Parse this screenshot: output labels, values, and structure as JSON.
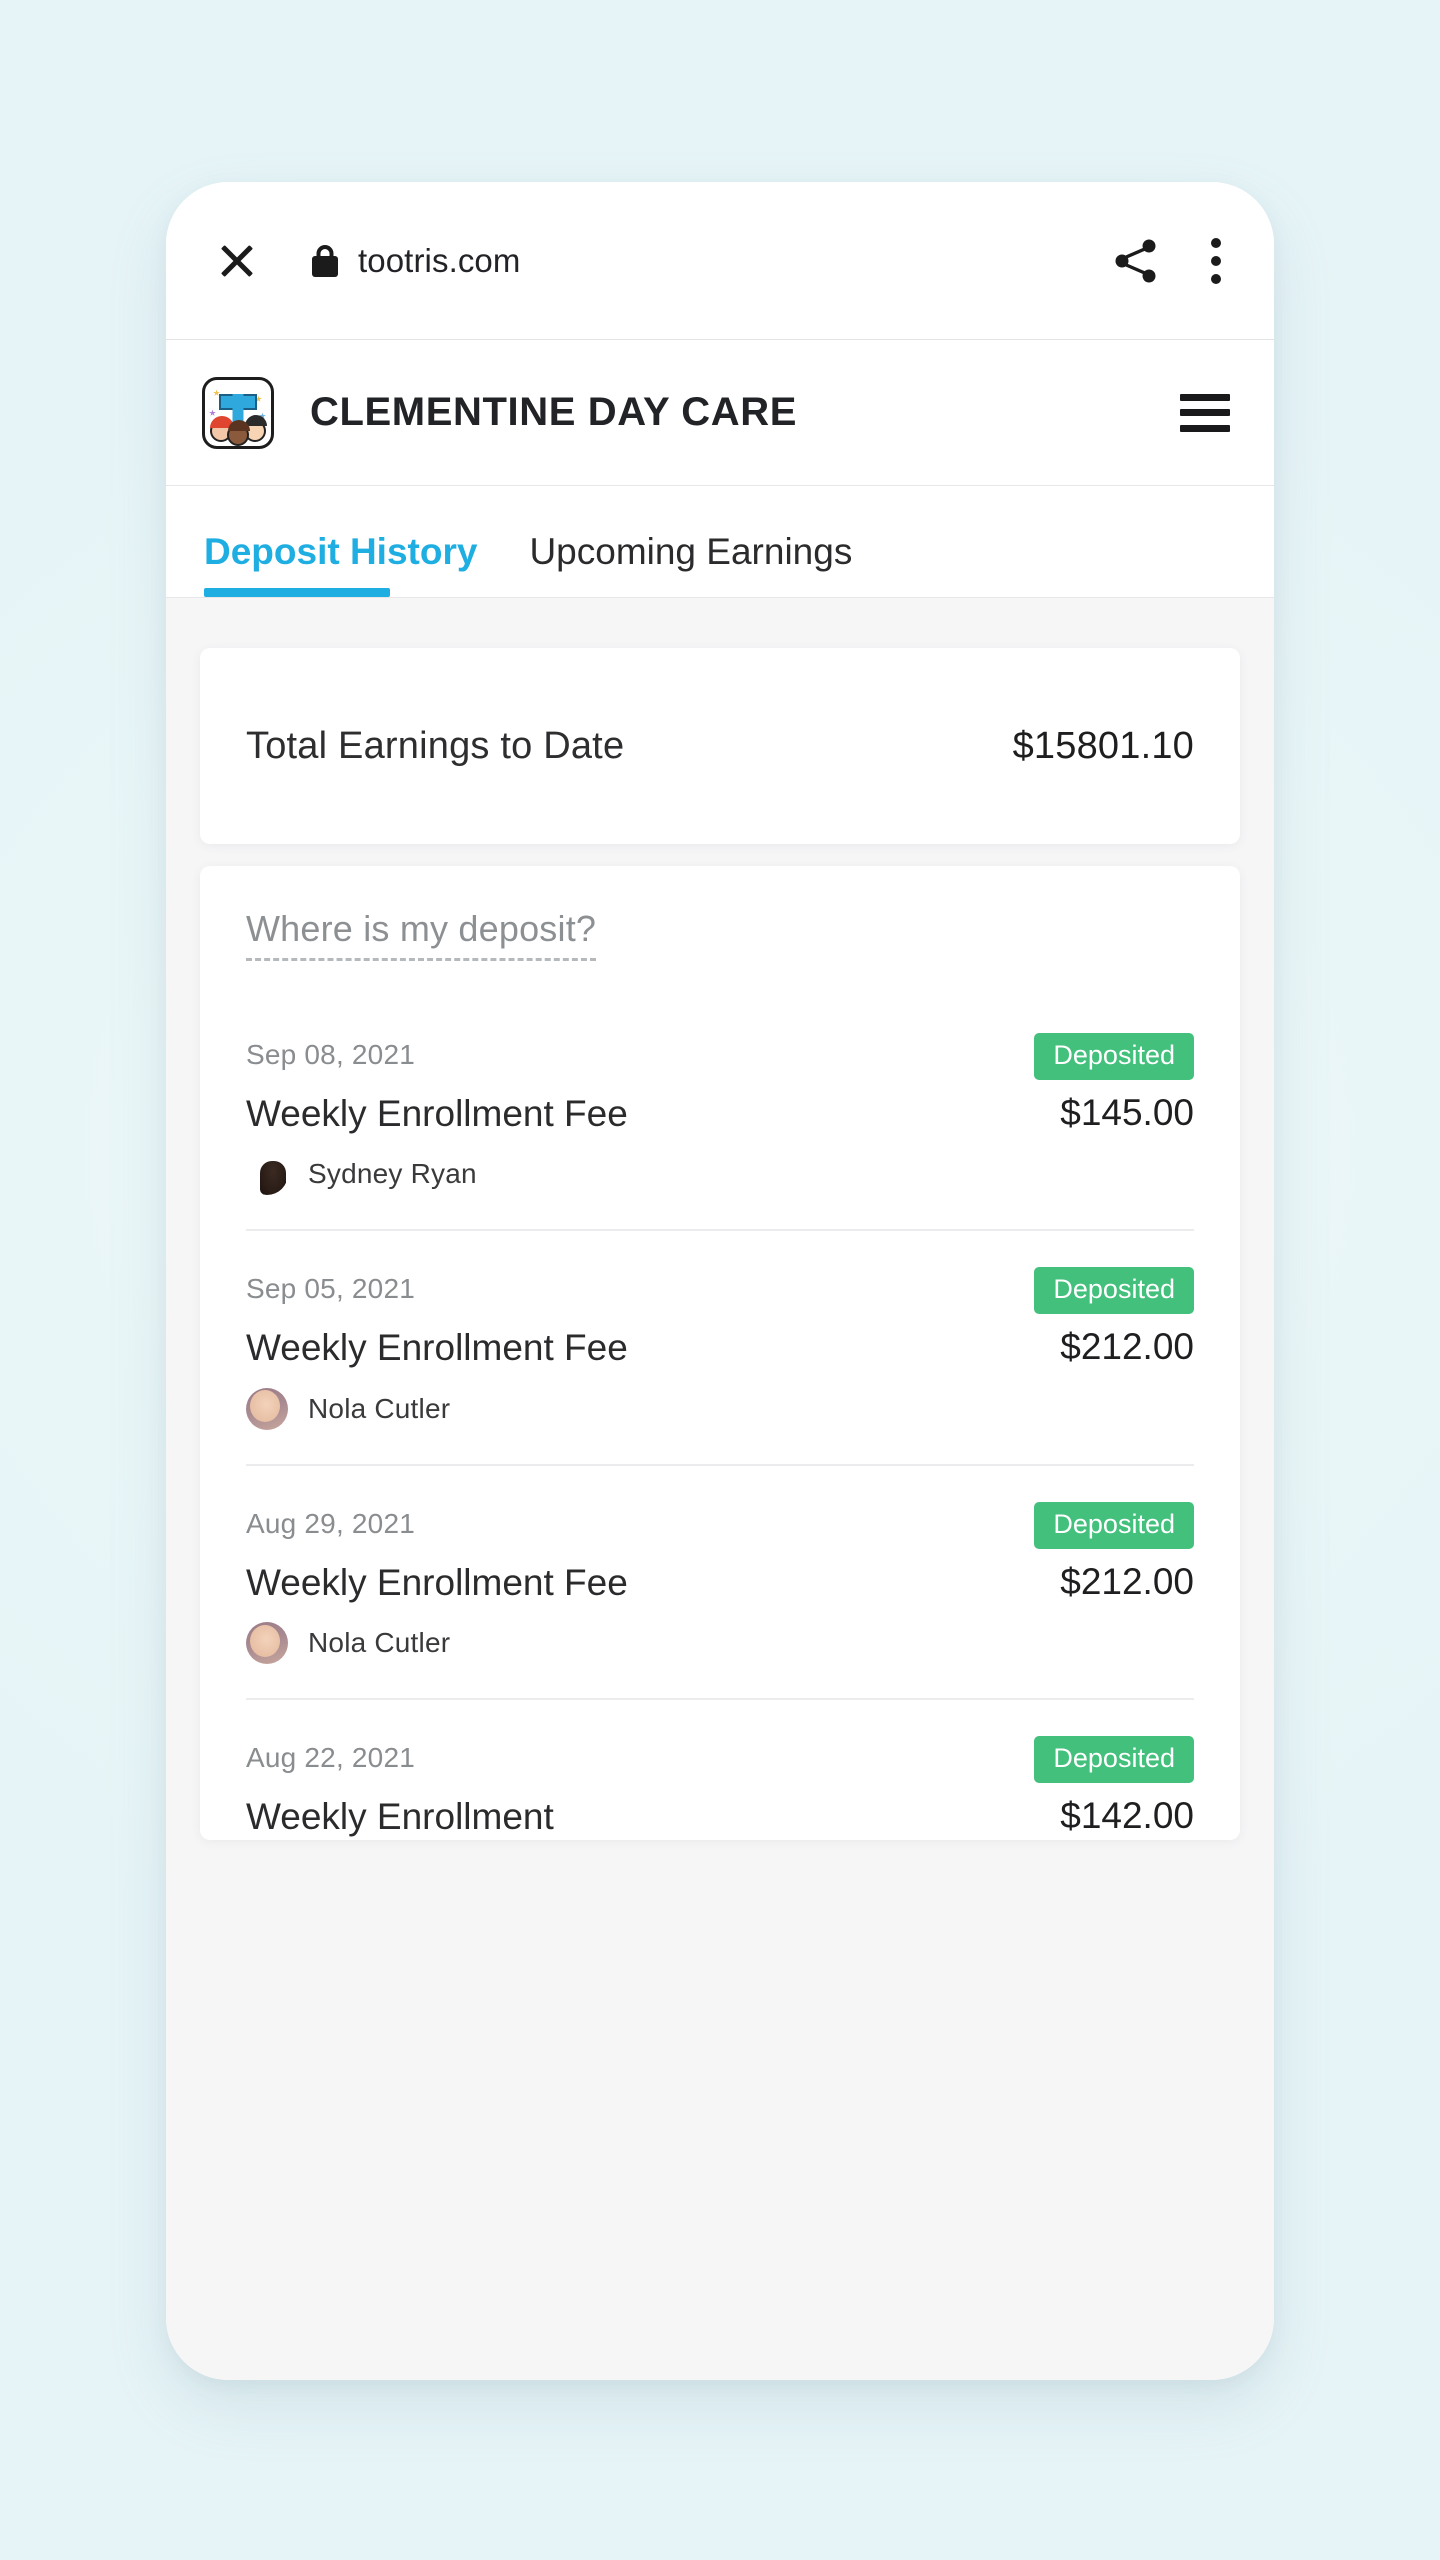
{
  "browser": {
    "close_label": "close-icon",
    "lock_label": "lock-icon",
    "url": "tootris.com",
    "share_label": "share-icon",
    "menu_label": "more-options-icon"
  },
  "header": {
    "logo_alt": "tootris-logo",
    "title": "CLEMENTINE DAY CARE",
    "hamburger_label": "menu-icon"
  },
  "tabs": [
    {
      "label": "Deposit History",
      "active": true
    },
    {
      "label": "Upcoming Earnings",
      "active": false
    }
  ],
  "summary": {
    "label": "Total Earnings to Date",
    "value": "$15801.10"
  },
  "deposits_panel": {
    "help_link": "Where is my deposit?",
    "rows": [
      {
        "date": "Sep 08, 2021",
        "status": "Deposited",
        "title": "Weekly Enrollment Fee",
        "amount": "$145.00",
        "person": "Sydney Ryan",
        "avatar": "sydney"
      },
      {
        "date": "Sep 05, 2021",
        "status": "Deposited",
        "title": "Weekly Enrollment Fee",
        "amount": "$212.00",
        "person": "Nola Cutler",
        "avatar": "nola"
      },
      {
        "date": "Aug 29, 2021",
        "status": "Deposited",
        "title": "Weekly Enrollment Fee",
        "amount": "$212.00",
        "person": "Nola Cutler",
        "avatar": "nola"
      },
      {
        "date": "Aug 22, 2021",
        "status": "Deposited",
        "title": "Weekly Enrollment",
        "amount": "$142.00",
        "person": "",
        "avatar": ""
      }
    ]
  },
  "colors": {
    "page_background": "#eaf7f9",
    "accent_blue": "#1faee2",
    "status_green": "#43c07c",
    "content_background": "#f6f6f7",
    "card_white": "#ffffff",
    "muted_text": "#8a8d90"
  }
}
